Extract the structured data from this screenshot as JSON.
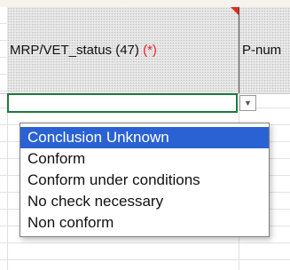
{
  "header": {
    "column1": {
      "label": "MRP/VET_status (47)",
      "required_marker": "(*)"
    },
    "column2": {
      "label": "P-num"
    }
  },
  "dropdown": {
    "icon": "chevron-down-icon",
    "selected": "Conclusion Unknown",
    "options": [
      "Conclusion Unknown",
      "Conform",
      "Conform under conditions",
      "No check necessary",
      "Non conform"
    ]
  },
  "colors": {
    "selection": "#2a62d4",
    "active_cell_border": "#1a7a3c",
    "required_marker": "#e8262b",
    "comment_marker": "#e32c1f"
  }
}
